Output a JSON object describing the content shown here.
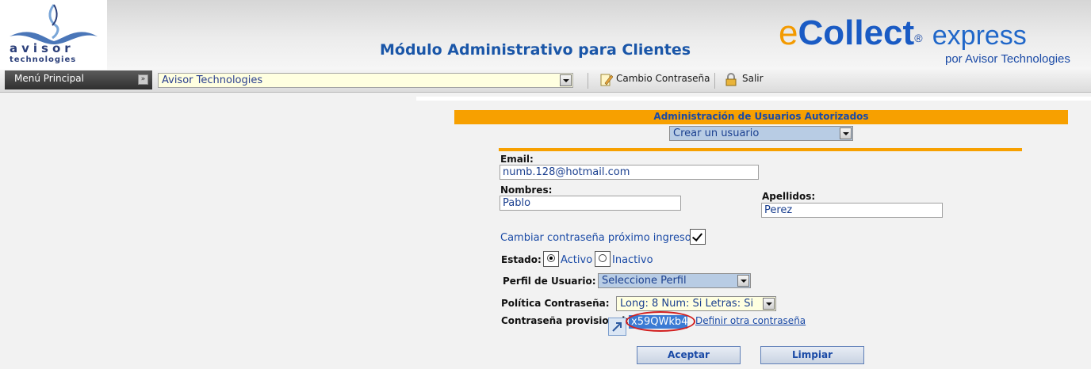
{
  "header": {
    "logo_name": "avisor",
    "logo_sub": "technologies",
    "module_title": "Módulo Administrativo para Clientes",
    "brand_e": "e",
    "brand_collect": "Collect",
    "brand_express": "express",
    "brand_tagline": "por Avisor Technologies",
    "brand_colors": {
      "orange": "#f39a00",
      "blue": "#1a4aa6"
    }
  },
  "toolbar": {
    "menu_label": "Menú Principal",
    "company_value": "Avisor Technologies",
    "change_password_label": "Cambio Contraseña",
    "exit_label": "Salir",
    "change_password_icon": "pencil-document-icon",
    "exit_icon": "padlock-icon"
  },
  "panel": {
    "title": "Administración de Usuarios Autorizados",
    "action_value": "Crear un usuario",
    "accent_color": "#f7a000"
  },
  "form": {
    "email_label": "Email:",
    "email_value": "numb.128@hotmail.com",
    "nombres_label": "Nombres:",
    "nombres_value": "Pablo",
    "apellidos_label": "Apellidos:",
    "apellidos_value": "Perez",
    "change_next_login_label": "Cambiar contraseña próximo ingreso",
    "change_next_login_checked": true,
    "estado_label": "Estado:",
    "estado_options": [
      "Activo",
      "Inactivo"
    ],
    "estado_selected": "Activo",
    "perfil_label": "Perfil de Usuario:",
    "perfil_value": "Seleccione Perfil",
    "politica_label": "Política Contraseña:",
    "politica_value": "Long: 8 Num: Si Letras: Si",
    "provisional_label": "Contraseña provisional:",
    "provisional_value": "x59QWkb4",
    "define_other_link": "Definir otra contraseña",
    "accept_button": "Aceptar",
    "clear_button": "Limpiar"
  }
}
